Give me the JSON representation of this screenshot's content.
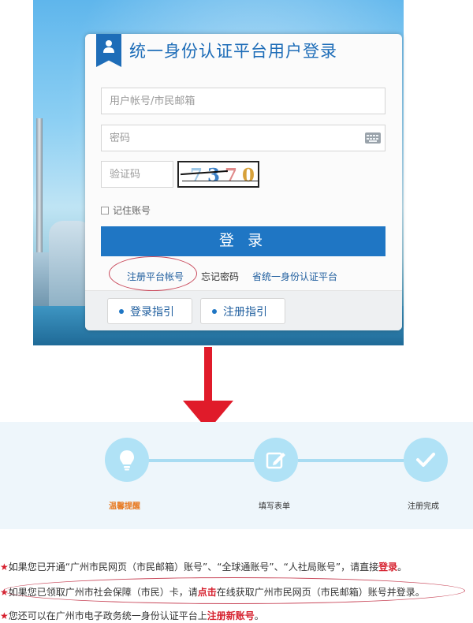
{
  "login_panel": {
    "title": "统一身份认证平台用户登录",
    "username_placeholder": "用户帐号/市民邮箱",
    "password_placeholder": "密码",
    "captcha_placeholder": "验证码",
    "captcha_digits": [
      "7",
      "3",
      "7",
      "0"
    ],
    "captcha_colors": [
      "#9fc9e8",
      "#3a7fc6",
      "#e08a8a",
      "#d7a13a"
    ],
    "remember_label": "记住账号",
    "login_button": "登 录",
    "links": {
      "register": "注册平台帐号",
      "forgot": "忘记密码",
      "province": "省统一身份认证平台"
    },
    "guide_buttons": [
      "登录指引",
      "注册指引"
    ]
  },
  "steps": [
    {
      "label": "温馨提醒",
      "icon": "lightbulb-icon",
      "active": true
    },
    {
      "label": "填写表单",
      "icon": "edit-form-icon",
      "active": false
    },
    {
      "label": "注册完成",
      "icon": "checkmark-icon",
      "active": false
    }
  ],
  "notes": {
    "star": "★",
    "line1": {
      "text": "如果您已开通“广州市民网页（市民邮箱）账号”、“全球通账号”、“人社局账号”，请直接",
      "highlight": "登录",
      "tail": "。"
    },
    "line2": {
      "pre": "如果您已领取广州市社会保障（市民）卡，请",
      "highlight": "点击",
      "post": "在线获取广州市民网页（市民邮箱）账号并登录。"
    },
    "line3": {
      "pre": "您还可以在广州市电子政务统一身份认证平台上",
      "highlight": "注册新账号",
      "tail": "。"
    }
  },
  "colors": {
    "brand_blue": "#1f76c4",
    "arrow_red": "#e01b2a",
    "step_circle": "#b0e2f6",
    "highlight_red": "#d6202e"
  }
}
